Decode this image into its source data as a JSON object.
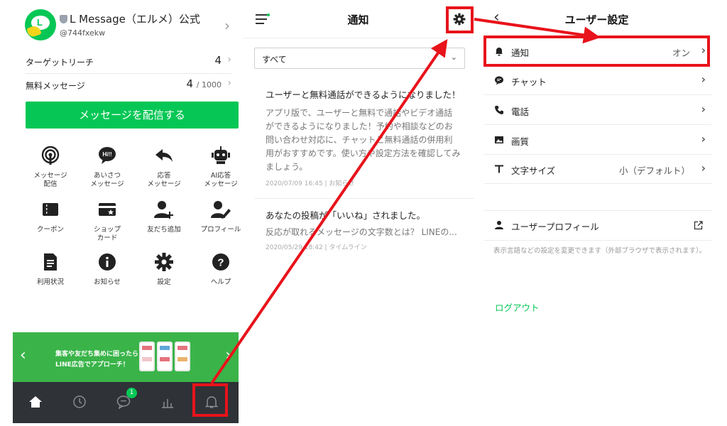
{
  "colors": {
    "brand_green": "#06c755",
    "banner_green": "#3ab449",
    "annotation_red": "#e8131b",
    "tabbar_dark": "#2f3237"
  },
  "account": {
    "name": "L Message（エルメ）公式",
    "id": "@744fxekw",
    "target_reach_label": "ターゲットリーチ",
    "target_reach_value": "4",
    "free_messages_label": "無料メッセージ",
    "free_messages_value": "4",
    "free_messages_total": "/ 1000",
    "send_button_label": "メッセージを配信する"
  },
  "menu": [
    {
      "label": "メッセージ\n配信",
      "icon": "broadcast-icon"
    },
    {
      "label": "あいさつ\nメッセージ",
      "icon": "hi-bubble-icon"
    },
    {
      "label": "応答\nメッセージ",
      "icon": "reply-icon"
    },
    {
      "label": "AI応答\nメッセージ",
      "icon": "robot-icon"
    },
    {
      "label": "クーポン",
      "icon": "coupon-icon"
    },
    {
      "label": "ショップ\nカード",
      "icon": "shop-card-icon"
    },
    {
      "label": "友だち追加",
      "icon": "add-friend-icon"
    },
    {
      "label": "プロフィール",
      "icon": "profile-edit-icon"
    },
    {
      "label": "利用状況",
      "icon": "usage-icon"
    },
    {
      "label": "お知らせ",
      "icon": "info-icon"
    },
    {
      "label": "設定",
      "icon": "gear-icon"
    },
    {
      "label": "ヘルプ",
      "icon": "help-icon"
    }
  ],
  "banner": {
    "text": "集客や友だち集めに困ったら\nLINE広告でアプローチ！"
  },
  "tabbar": {
    "chat_badge": "1",
    "tabs": [
      "home-icon",
      "clock-icon",
      "chat-icon",
      "chart-icon",
      "bell-icon"
    ]
  },
  "notifications": {
    "title": "通知",
    "filter_value": "すべて",
    "items": [
      {
        "title": "ユーザーと無料通話ができるようになりました！",
        "body": "アプリ版で、ユーザーと無料で通話やビデオ通話ができるようになりました！予約や相談などのお問い合わせ対応に、チャットと無料通話の併用利用がおすすめです。使い方や設定方法を確認してみましょう。",
        "meta": "2020/07/09 16:45 | お知らせ"
      },
      {
        "title": "あなたの投稿が「いいね」されました。",
        "body": "反応が取れるメッセージの文字数とは？ LINEの...",
        "meta": "2020/05/29 18:42 | タイムライン"
      }
    ]
  },
  "settings": {
    "title": "ユーザー設定",
    "rows": [
      {
        "label": "通知",
        "value": "オン",
        "icon": "bell-icon"
      },
      {
        "label": "チャット",
        "value": "",
        "icon": "chat-icon"
      },
      {
        "label": "電話",
        "value": "",
        "icon": "phone-icon"
      },
      {
        "label": "画質",
        "value": "",
        "icon": "image-icon"
      },
      {
        "label": "文字サイズ",
        "value": "小（デフォルト）",
        "icon": "text-size-icon"
      }
    ],
    "profile_label": "ユーザープロフィール",
    "profile_note": "表示言語などの設定を変更できます（外部ブラウザで表示されます）。",
    "logout_label": "ログアウト"
  }
}
